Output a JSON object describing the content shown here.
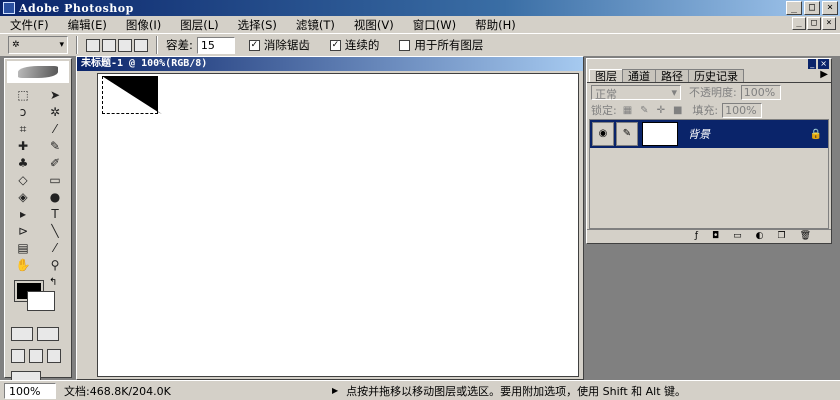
{
  "window": {
    "title": "Adobe Photoshop",
    "btn_min": "_",
    "btn_max": "□",
    "btn_close": "×"
  },
  "menu": [
    "文件(F)",
    "编辑(E)",
    "图像(I)",
    "图层(L)",
    "选择(S)",
    "滤镜(T)",
    "视图(V)",
    "窗口(W)",
    "帮助(H)"
  ],
  "options": {
    "tolerance_label": "容差:",
    "tolerance_value": "15",
    "antialias_label": "消除锯齿",
    "antialias_checked": "✓",
    "contiguous_label": "连续的",
    "contiguous_checked": "✓",
    "all_layers_label": "用于所有图层"
  },
  "document": {
    "title": "未标题-1 @ 100%(RGB/8)"
  },
  "layers_palette": {
    "tabs": [
      "图层",
      "通道",
      "路径",
      "历史记录"
    ],
    "blend_mode": "正常",
    "opacity_label": "不透明度:",
    "opacity_value": "100%",
    "lock_label": "锁定:",
    "fill_label": "填充:",
    "fill_value": "100%",
    "layer_name": "背景"
  },
  "status": {
    "zoom": "100%",
    "doc_size": "文档:468.8K/204.0K",
    "hint": "点按并拖移以移动图层或选区。要用附加选项，使用 Shift 和 Alt 键。"
  },
  "colors": {
    "title_active": "#0a246a",
    "chrome": "#d4d0c8",
    "workspace": "#808080",
    "foreground": "#000000",
    "background": "#ffffff"
  }
}
